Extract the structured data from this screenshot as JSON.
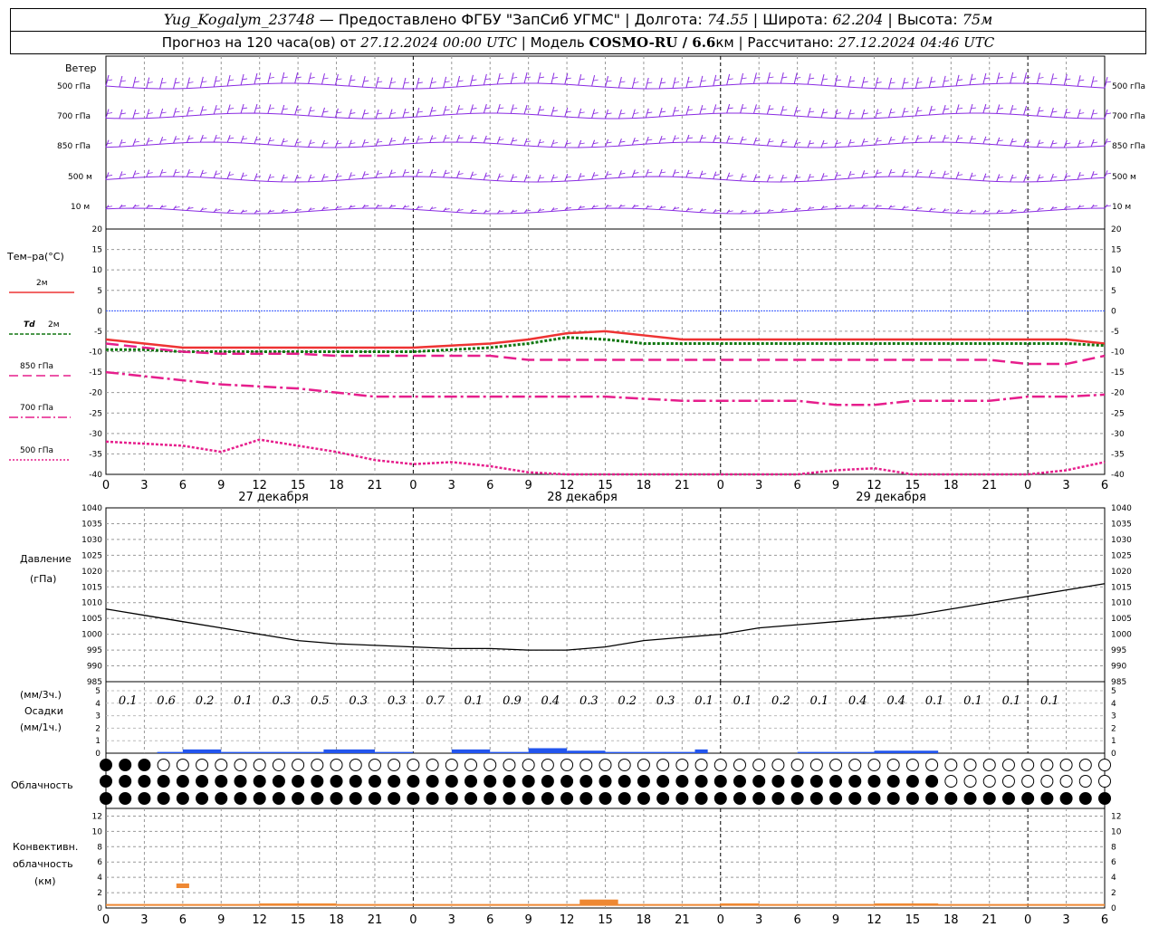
{
  "header": {
    "station": "Yug_Kogalym_23748",
    "provider": "— Предоставлено ФГБУ \"ЗапСиб УГМС\"",
    "lon_label": "Долгота:",
    "lon": "74.55",
    "lat_label": "Широта:",
    "lat": "62.204",
    "alt_label": "Высота:",
    "alt": "75м",
    "forecast_label": "Прогноз на 120 часа(ов) от",
    "forecast_from": "27.12.2024 00:00 UTC",
    "model_label": "Модель",
    "model": "COSMO-RU / 6.6",
    "model_unit": "км",
    "computed_label": "Рассчитано:",
    "computed": "27.12.2024 04:46 UTC"
  },
  "labels": {
    "wind": "Ветер",
    "wind_levels": [
      "500 гПа",
      "700 гПа",
      "850 гПа",
      "500 м",
      "10 м"
    ],
    "temp": "Тем–ра(°С)",
    "t2m": "2м",
    "td": "Td",
    "td2m": "2м",
    "t850": "850 гПа",
    "t700": "700 гПа",
    "t500": "500 гПа",
    "pressure": "Давление",
    "pressure_unit": "(гПа)",
    "precip1": "(мм/3ч.)",
    "precip2": "Осадки",
    "precip3": "(мм/1ч.)",
    "cloud": "Облачность",
    "conv1": "Конвективн.",
    "conv2": "облачность",
    "conv3": "(км)"
  },
  "x_ticks": [
    "0",
    "3",
    "6",
    "9",
    "12",
    "15",
    "18",
    "21",
    "0",
    "3",
    "6",
    "9",
    "12",
    "15",
    "18",
    "21",
    "0",
    "3",
    "6",
    "9",
    "12",
    "15",
    "18",
    "21",
    "0",
    "3",
    "6"
  ],
  "day_labels": [
    "27 декабря",
    "28 декабря",
    "29 декабря"
  ],
  "colors": {
    "wind": "#8a2be2",
    "t2m": "#ee3333",
    "td": "#117711",
    "t_upper": "#e61e8c",
    "pressure": "#000000",
    "precip": "#2255ee",
    "conv": "#ee8833",
    "zero_line": "#3355ff"
  },
  "chart_data": [
    {
      "type": "line",
      "title": "Тем–ра(°С)",
      "x_hours": [
        0,
        3,
        6,
        9,
        12,
        15,
        18,
        21,
        24,
        27,
        30,
        33,
        36,
        39,
        42,
        45,
        48,
        51,
        54,
        57,
        60,
        63,
        66,
        69,
        72,
        75,
        78
      ],
      "ylim": [
        -40,
        20
      ],
      "yticks": [
        20,
        15,
        10,
        5,
        0,
        -5,
        -10,
        -15,
        -20,
        -25,
        -30,
        -35,
        -40
      ],
      "series": [
        {
          "name": "2м",
          "values": [
            -7,
            -8,
            -9,
            -9,
            -9,
            -9,
            -9,
            -9,
            -9,
            -8.5,
            -8,
            -7,
            -5.5,
            -5,
            -6,
            -7,
            -7,
            -7,
            -7,
            -7,
            -7,
            -7,
            -7,
            -7,
            -7,
            -7,
            -8
          ]
        },
        {
          "name": "Td 2м",
          "values": [
            -9.5,
            -9.5,
            -10,
            -10,
            -10,
            -10,
            -10,
            -10,
            -10,
            -9.5,
            -9,
            -8,
            -6.5,
            -7,
            -8,
            -8,
            -8,
            -8,
            -8,
            -8,
            -8,
            -8,
            -8,
            -8,
            -8,
            -8,
            -8.5
          ]
        },
        {
          "name": "850 гПа",
          "values": [
            -8,
            -9,
            -10,
            -10.5,
            -10.5,
            -10.5,
            -11,
            -11,
            -11,
            -11,
            -11,
            -12,
            -12,
            -12,
            -12,
            -12,
            -12,
            -12,
            -12,
            -12,
            -12,
            -12,
            -12,
            -12,
            -13,
            -13,
            -11
          ]
        },
        {
          "name": "700 гПа",
          "values": [
            -15,
            -16,
            -17,
            -18,
            -18.5,
            -19,
            -20,
            -21,
            -21,
            -21,
            -21,
            -21,
            -21,
            -21,
            -21.5,
            -22,
            -22,
            -22,
            -22,
            -23,
            -23,
            -22,
            -22,
            -22,
            -21,
            -21,
            -20.5
          ]
        },
        {
          "name": "500 гПа",
          "values": [
            -32,
            -32.5,
            -33,
            -34.5,
            -31.5,
            -33,
            -34.5,
            -36.5,
            -37.5,
            -37,
            -38,
            -39.5,
            -41,
            -41,
            -41,
            -41,
            -41,
            -41,
            -41,
            -39,
            -38.5,
            -40,
            -41,
            -41,
            -40,
            -39,
            -37
          ]
        }
      ]
    },
    {
      "type": "line",
      "title": "Давление (гПа)",
      "x_hours": [
        0,
        3,
        6,
        9,
        12,
        15,
        18,
        21,
        24,
        27,
        30,
        33,
        36,
        39,
        42,
        45,
        48,
        51,
        54,
        57,
        60,
        63,
        66,
        69,
        72,
        75,
        78
      ],
      "ylim": [
        985,
        1040
      ],
      "yticks": [
        1040,
        1035,
        1030,
        1025,
        1020,
        1015,
        1010,
        1005,
        1000,
        995,
        990,
        985
      ],
      "series": [
        {
          "name": "Давление",
          "values": [
            1008,
            1006,
            1004,
            1002,
            1000,
            998,
            997,
            996.5,
            996,
            995.5,
            995.5,
            995,
            995,
            996,
            998,
            999,
            1000,
            1002,
            1003,
            1004,
            1005,
            1006,
            1008,
            1010,
            1012,
            1014,
            1016
          ]
        }
      ]
    },
    {
      "type": "bar",
      "title": "Осадки (мм/3ч.)",
      "value_labels": [
        "0.1",
        "0.6",
        "0.2",
        "0.1",
        "0.3",
        "0.5",
        "0.3",
        "0.3",
        "0.7",
        "0.1",
        "0.9",
        "0.4",
        "0.3",
        "0.2",
        "0.3",
        "0.1",
        "0.1",
        "0.2",
        "0.1",
        "0.4",
        "0.4",
        "0.1",
        "0.1",
        "0.1",
        "0.1"
      ],
      "ylim": [
        0,
        5
      ],
      "yticks": [
        5,
        4,
        3,
        2,
        1,
        0
      ],
      "hourly_bars": [
        {
          "from": 4,
          "to": 6,
          "value": 0.1
        },
        {
          "from": 6,
          "to": 9,
          "value": 0.3
        },
        {
          "from": 9,
          "to": 24,
          "value": 0.1
        },
        {
          "from": 17,
          "to": 21,
          "value": 0.3
        },
        {
          "from": 27,
          "to": 30,
          "value": 0.3
        },
        {
          "from": 30,
          "to": 33,
          "value": 0.1
        },
        {
          "from": 33,
          "to": 36,
          "value": 0.4
        },
        {
          "from": 36,
          "to": 39,
          "value": 0.2
        },
        {
          "from": 39,
          "to": 47,
          "value": 0.1
        },
        {
          "from": 46,
          "to": 47,
          "value": 0.3
        },
        {
          "from": 54,
          "to": 60,
          "value": 0.1
        },
        {
          "from": 60,
          "to": 65,
          "value": 0.2
        }
      ]
    },
    {
      "type": "bar",
      "title": "Конвективн. облачность (км)",
      "ylim": [
        0,
        13
      ],
      "yticks": [
        12,
        10,
        8,
        6,
        4,
        2,
        0
      ],
      "bars": [
        {
          "from": 5.5,
          "to": 6.5,
          "bottom": 2.6,
          "top": 3.2
        },
        {
          "from": 37,
          "to": 40,
          "bottom": 0.3,
          "top": 1.1
        },
        {
          "from": 12,
          "to": 18,
          "bottom": 0.3,
          "top": 0.6
        },
        {
          "from": 48,
          "to": 51,
          "bottom": 0.3,
          "top": 0.6
        },
        {
          "from": 60,
          "to": 65,
          "bottom": 0.3,
          "top": 0.6
        }
      ]
    }
  ]
}
